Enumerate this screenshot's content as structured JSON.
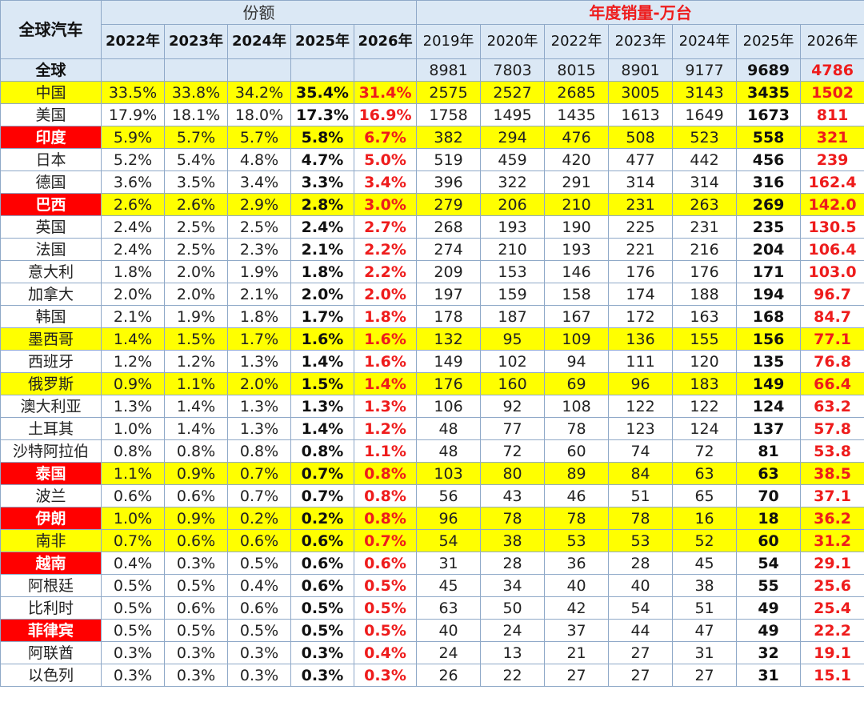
{
  "header": {
    "corner": "全球汽车",
    "share_group": "份额",
    "sales_group": "年度销量-万台",
    "share_years": [
      "2022年",
      "2023年",
      "2024年",
      "2025年",
      "2026年"
    ],
    "sales_years": [
      "2019年",
      "2020年",
      "2022年",
      "2023年",
      "2024年",
      "2025年",
      "2026年"
    ]
  },
  "rows": [
    {
      "name": "全球",
      "style": "global",
      "shares": [
        "",
        "",
        "",
        "",
        ""
      ],
      "sales": [
        "8981",
        "7803",
        "8015",
        "8901",
        "9177",
        "9689",
        "4786"
      ]
    },
    {
      "name": "中国",
      "style": "hl",
      "shares": [
        "33.5%",
        "33.8%",
        "34.2%",
        "35.4%",
        "31.4%"
      ],
      "sales": [
        "2575",
        "2527",
        "2685",
        "3005",
        "3143",
        "3435",
        "1502"
      ]
    },
    {
      "name": "美国",
      "style": "",
      "shares": [
        "17.9%",
        "18.1%",
        "18.0%",
        "17.3%",
        "16.9%"
      ],
      "sales": [
        "1758",
        "1495",
        "1435",
        "1613",
        "1649",
        "1673",
        "811"
      ]
    },
    {
      "name": "印度",
      "style": "hl flag",
      "shares": [
        "5.9%",
        "5.7%",
        "5.7%",
        "5.8%",
        "6.7%"
      ],
      "sales": [
        "382",
        "294",
        "476",
        "508",
        "523",
        "558",
        "321"
      ]
    },
    {
      "name": "日本",
      "style": "",
      "shares": [
        "5.2%",
        "5.4%",
        "4.8%",
        "4.7%",
        "5.0%"
      ],
      "sales": [
        "519",
        "459",
        "420",
        "477",
        "442",
        "456",
        "239"
      ]
    },
    {
      "name": "德国",
      "style": "",
      "shares": [
        "3.6%",
        "3.5%",
        "3.4%",
        "3.3%",
        "3.4%"
      ],
      "sales": [
        "396",
        "322",
        "291",
        "314",
        "314",
        "316",
        "162.4"
      ]
    },
    {
      "name": "巴西",
      "style": "hl flag",
      "shares": [
        "2.6%",
        "2.6%",
        "2.9%",
        "2.8%",
        "3.0%"
      ],
      "sales": [
        "279",
        "206",
        "210",
        "231",
        "263",
        "269",
        "142.0"
      ]
    },
    {
      "name": "英国",
      "style": "",
      "shares": [
        "2.4%",
        "2.5%",
        "2.5%",
        "2.4%",
        "2.7%"
      ],
      "sales": [
        "268",
        "193",
        "190",
        "225",
        "231",
        "235",
        "130.5"
      ]
    },
    {
      "name": "法国",
      "style": "",
      "shares": [
        "2.4%",
        "2.5%",
        "2.3%",
        "2.1%",
        "2.2%"
      ],
      "sales": [
        "274",
        "210",
        "193",
        "221",
        "216",
        "204",
        "106.4"
      ]
    },
    {
      "name": "意大利",
      "style": "",
      "shares": [
        "1.8%",
        "2.0%",
        "1.9%",
        "1.8%",
        "2.2%"
      ],
      "sales": [
        "209",
        "153",
        "146",
        "176",
        "176",
        "171",
        "103.0"
      ]
    },
    {
      "name": "加拿大",
      "style": "",
      "shares": [
        "2.0%",
        "2.0%",
        "2.1%",
        "2.0%",
        "2.0%"
      ],
      "sales": [
        "197",
        "159",
        "158",
        "174",
        "188",
        "194",
        "96.7"
      ]
    },
    {
      "name": "韩国",
      "style": "",
      "shares": [
        "2.1%",
        "1.9%",
        "1.8%",
        "1.7%",
        "1.8%"
      ],
      "sales": [
        "178",
        "187",
        "167",
        "172",
        "163",
        "168",
        "84.7"
      ]
    },
    {
      "name": "墨西哥",
      "style": "hl",
      "shares": [
        "1.4%",
        "1.5%",
        "1.7%",
        "1.6%",
        "1.6%"
      ],
      "sales": [
        "132",
        "95",
        "109",
        "136",
        "155",
        "156",
        "77.1"
      ]
    },
    {
      "name": "西班牙",
      "style": "",
      "shares": [
        "1.2%",
        "1.2%",
        "1.3%",
        "1.4%",
        "1.6%"
      ],
      "sales": [
        "149",
        "102",
        "94",
        "111",
        "120",
        "135",
        "76.8"
      ]
    },
    {
      "name": "俄罗斯",
      "style": "hl",
      "shares": [
        "0.9%",
        "1.1%",
        "2.0%",
        "1.5%",
        "1.4%"
      ],
      "sales": [
        "176",
        "160",
        "69",
        "96",
        "183",
        "149",
        "66.4"
      ]
    },
    {
      "name": "澳大利亚",
      "style": "",
      "shares": [
        "1.3%",
        "1.4%",
        "1.3%",
        "1.3%",
        "1.3%"
      ],
      "sales": [
        "106",
        "92",
        "108",
        "122",
        "122",
        "124",
        "63.2"
      ]
    },
    {
      "name": "土耳其",
      "style": "",
      "shares": [
        "1.0%",
        "1.4%",
        "1.3%",
        "1.4%",
        "1.2%"
      ],
      "sales": [
        "48",
        "77",
        "78",
        "123",
        "124",
        "137",
        "57.8"
      ]
    },
    {
      "name": "沙特阿拉伯",
      "style": "",
      "shares": [
        "0.8%",
        "0.8%",
        "0.8%",
        "0.8%",
        "1.1%"
      ],
      "sales": [
        "48",
        "72",
        "60",
        "74",
        "72",
        "81",
        "53.8"
      ]
    },
    {
      "name": "泰国",
      "style": "hl flag",
      "shares": [
        "1.1%",
        "0.9%",
        "0.7%",
        "0.7%",
        "0.8%"
      ],
      "sales": [
        "103",
        "80",
        "89",
        "84",
        "63",
        "63",
        "38.5"
      ]
    },
    {
      "name": "波兰",
      "style": "",
      "shares": [
        "0.6%",
        "0.6%",
        "0.7%",
        "0.7%",
        "0.8%"
      ],
      "sales": [
        "56",
        "43",
        "46",
        "51",
        "65",
        "70",
        "37.1"
      ]
    },
    {
      "name": "伊朗",
      "style": "hl flag",
      "shares": [
        "1.0%",
        "0.9%",
        "0.2%",
        "0.2%",
        "0.8%"
      ],
      "sales": [
        "96",
        "78",
        "78",
        "78",
        "16",
        "18",
        "36.2"
      ]
    },
    {
      "name": "南非",
      "style": "hl",
      "shares": [
        "0.7%",
        "0.6%",
        "0.6%",
        "0.6%",
        "0.7%"
      ],
      "sales": [
        "54",
        "38",
        "53",
        "53",
        "52",
        "60",
        "31.2"
      ]
    },
    {
      "name": "越南",
      "style": "flag",
      "shares": [
        "0.4%",
        "0.3%",
        "0.5%",
        "0.6%",
        "0.6%"
      ],
      "sales": [
        "31",
        "28",
        "36",
        "28",
        "45",
        "54",
        "29.1"
      ]
    },
    {
      "name": "阿根廷",
      "style": "",
      "shares": [
        "0.5%",
        "0.5%",
        "0.4%",
        "0.6%",
        "0.5%"
      ],
      "sales": [
        "45",
        "34",
        "40",
        "40",
        "38",
        "55",
        "25.6"
      ]
    },
    {
      "name": "比利时",
      "style": "",
      "shares": [
        "0.5%",
        "0.6%",
        "0.6%",
        "0.5%",
        "0.5%"
      ],
      "sales": [
        "63",
        "50",
        "42",
        "54",
        "51",
        "49",
        "25.4"
      ]
    },
    {
      "name": "菲律宾",
      "style": "flag",
      "shares": [
        "0.5%",
        "0.5%",
        "0.5%",
        "0.5%",
        "0.5%"
      ],
      "sales": [
        "40",
        "24",
        "37",
        "44",
        "47",
        "49",
        "22.2"
      ]
    },
    {
      "name": "阿联酋",
      "style": "",
      "shares": [
        "0.3%",
        "0.3%",
        "0.3%",
        "0.3%",
        "0.4%"
      ],
      "sales": [
        "24",
        "13",
        "21",
        "27",
        "31",
        "32",
        "19.1"
      ]
    },
    {
      "name": "以色列",
      "style": "",
      "shares": [
        "0.3%",
        "0.3%",
        "0.3%",
        "0.3%",
        "0.3%"
      ],
      "sales": [
        "26",
        "22",
        "27",
        "27",
        "27",
        "31",
        "15.1"
      ]
    }
  ]
}
